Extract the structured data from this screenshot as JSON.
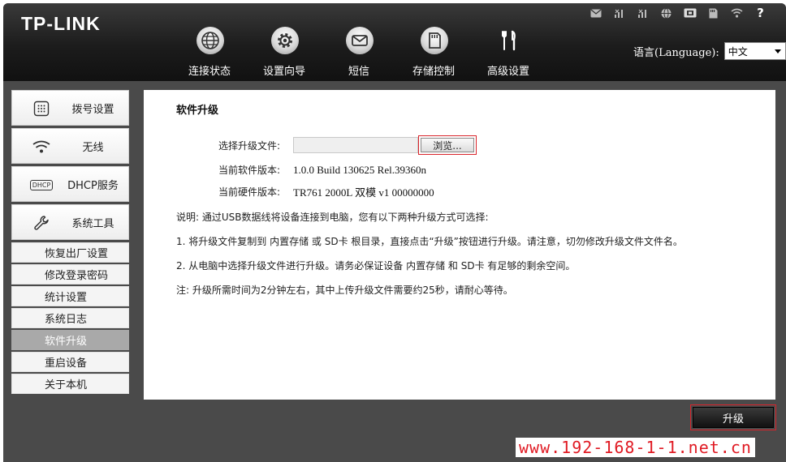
{
  "brand": {
    "logo": "TP-LINK"
  },
  "status_icons": [
    "mail-icon",
    "signal-icon",
    "signal-icon-2",
    "globe-icon",
    "sim-icon",
    "sd-card-icon",
    "wifi-icon",
    "help-icon"
  ],
  "help_glyph": "?",
  "nav": {
    "items": [
      {
        "label": "连接状态",
        "icon": "globe-icon"
      },
      {
        "label": "设置向导",
        "icon": "gear-icon"
      },
      {
        "label": "短信",
        "icon": "mail-icon"
      },
      {
        "label": "存储控制",
        "icon": "sd-card-icon"
      },
      {
        "label": "高级设置",
        "icon": "tools-icon"
      }
    ]
  },
  "language": {
    "label": "语言(Language):",
    "selected": "中文"
  },
  "sidebar": {
    "main_items": [
      {
        "label": "拨号设置",
        "icon": "dialpad-icon"
      },
      {
        "label": "无线",
        "icon": "wifi-icon"
      },
      {
        "label": "DHCP服务",
        "icon": "dhcp-icon",
        "icon_text": "DHCP"
      },
      {
        "label": "系统工具",
        "icon": "wrench-icon"
      }
    ],
    "sub_items": [
      {
        "label": "恢复出厂设置",
        "active": false
      },
      {
        "label": "修改登录密码",
        "active": false
      },
      {
        "label": "统计设置",
        "active": false
      },
      {
        "label": "系统日志",
        "active": false
      },
      {
        "label": "软件升级",
        "active": true
      },
      {
        "label": "重启设备",
        "active": false
      },
      {
        "label": "关于本机",
        "active": false
      }
    ]
  },
  "main": {
    "title": "软件升级",
    "file_label": "选择升级文件:",
    "browse_label": "浏览...",
    "sw_label": "当前软件版本:",
    "sw_value": "1.0.0 Build 130625 Rel.39360n",
    "hw_label": "当前硬件版本:",
    "hw_value": "TR761 2000L 双模  v1 00000000",
    "note_intro": "说明: 通过USB数据线将设备连接到电脑，您有以下两种升级方式可选择:",
    "note_1": "1. 将升级文件复制到  内置存储  或  SD卡  根目录，直接点击“升级”按钮进行升级。请注意，切勿修改升级文件文件名。",
    "note_2": "2. 从电脑中选择升级文件进行升级。请务必保证设备  内置存储  和  SD卡  有足够的剩余空间。",
    "note_3": "注: 升级所需时间为2分钟左右，其中上传升级文件需要约25秒，请耐心等待。"
  },
  "actions": {
    "upgrade_label": "升级"
  },
  "watermark": "www.192-168-1-1.net.cn",
  "colors": {
    "accent_red": "#d9232a",
    "header": "#1c1c1c",
    "active_menu": "#a9a9a9"
  }
}
